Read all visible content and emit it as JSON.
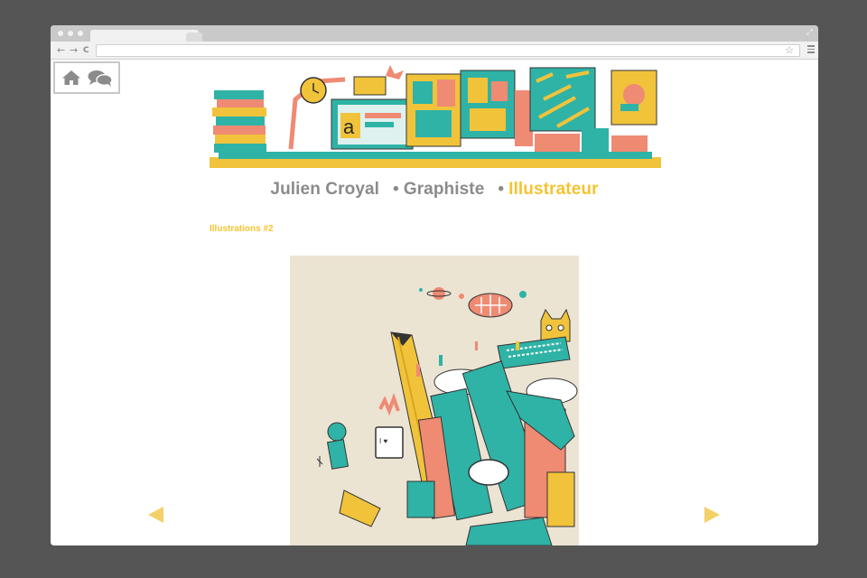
{
  "browser": {
    "controls": {
      "back": "←",
      "forward": "→",
      "reload": "C",
      "bookmark": "☆"
    },
    "url": ""
  },
  "site": {
    "quick_links": [
      {
        "icon": "home-icon"
      },
      {
        "icon": "chat-icon"
      }
    ],
    "nav": {
      "name": "Julien Croyal",
      "separator": "•",
      "items": [
        {
          "label": "Graphiste",
          "active": false
        },
        {
          "label": "Illustrateur",
          "active": true
        }
      ]
    },
    "section_title": "Illustrations #2",
    "gallery": {
      "prev_icon": "triangle-left-icon",
      "next_icon": "triangle-right-icon"
    },
    "colors": {
      "accent": "#f4c430",
      "nav_gray": "#8b8b8b",
      "teal": "#2fb3a6",
      "coral": "#ef8a73",
      "arrow": "#f4d068"
    }
  }
}
